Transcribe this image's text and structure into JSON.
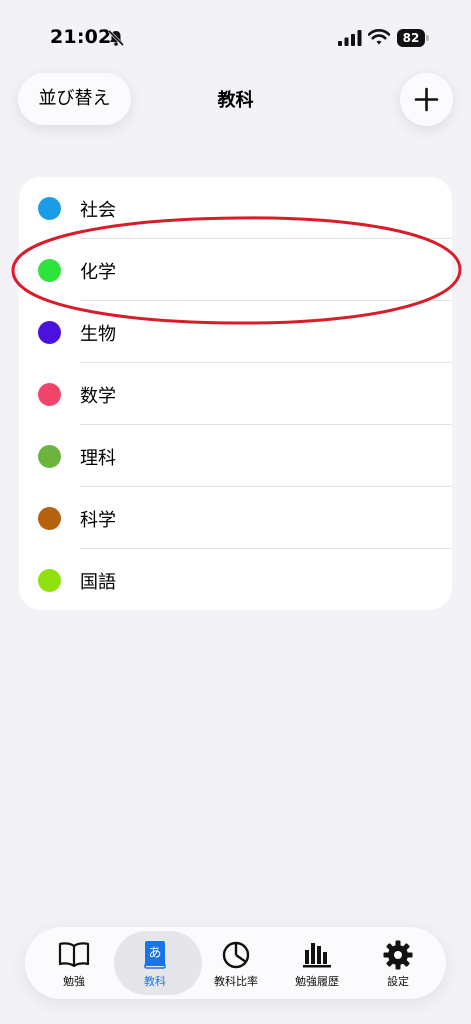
{
  "status_bar": {
    "time": "21:02",
    "battery_level": "82"
  },
  "nav": {
    "sort_label": "並び替え",
    "title": "教科"
  },
  "subjects": [
    {
      "name": "社会",
      "color": "#1b9ce6"
    },
    {
      "name": "化学",
      "color": "#2ee33a"
    },
    {
      "name": "生物",
      "color": "#4b11df"
    },
    {
      "name": "数学",
      "color": "#f2456a"
    },
    {
      "name": "理科",
      "color": "#6db43f"
    },
    {
      "name": "科学",
      "color": "#b5620d"
    },
    {
      "name": "国語",
      "color": "#8fe00c"
    }
  ],
  "annotation_color": "#d81c2a",
  "tabs": [
    {
      "label": "勉強",
      "icon": "book-icon"
    },
    {
      "label": "教科",
      "icon": "dictionary-book-icon",
      "active": true
    },
    {
      "label": "教科比率",
      "icon": "pie-chart-icon"
    },
    {
      "label": "勉強履歴",
      "icon": "bar-chart-icon"
    },
    {
      "label": "設定",
      "icon": "gear-icon"
    }
  ],
  "accent_color": "#1a73e8"
}
